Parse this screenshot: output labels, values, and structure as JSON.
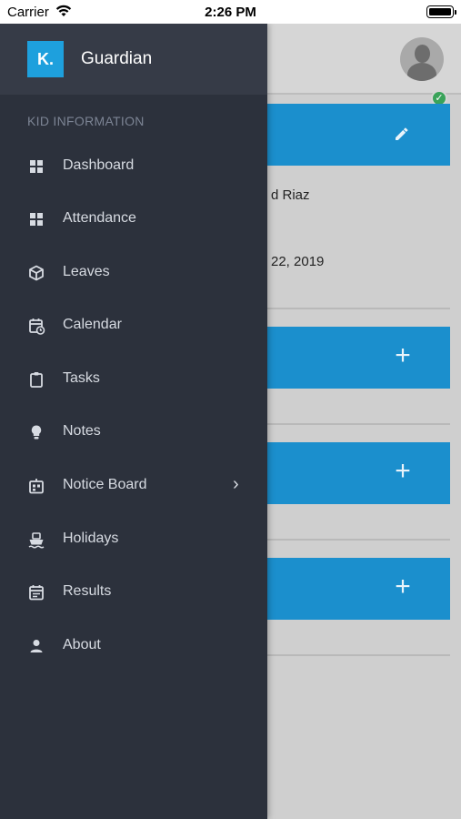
{
  "status_bar": {
    "carrier": "Carrier",
    "time": "2:26 PM"
  },
  "drawer": {
    "logo_text": "K.",
    "title": "Guardian",
    "section_label": "KID INFORMATION",
    "items": [
      {
        "label": "Dashboard",
        "icon": "dashboard-icon"
      },
      {
        "label": "Attendance",
        "icon": "attendance-icon"
      },
      {
        "label": "Leaves",
        "icon": "leaves-icon"
      },
      {
        "label": "Calendar",
        "icon": "calendar-icon"
      },
      {
        "label": "Tasks",
        "icon": "tasks-icon"
      },
      {
        "label": "Notes",
        "icon": "notes-icon"
      },
      {
        "label": "Notice Board",
        "icon": "notice-board-icon",
        "has_submenu": true
      },
      {
        "label": "Holidays",
        "icon": "holidays-icon"
      },
      {
        "label": "Results",
        "icon": "results-icon"
      },
      {
        "label": "About",
        "icon": "about-icon"
      }
    ]
  },
  "background": {
    "card1_line1": "d Riaz",
    "card1_line2": "22, 2019"
  },
  "colors": {
    "drawer_bg": "#2c313c",
    "drawer_header_bg": "#363b47",
    "accent": "#1ea0dd",
    "card_header": "#1b8fcd"
  }
}
